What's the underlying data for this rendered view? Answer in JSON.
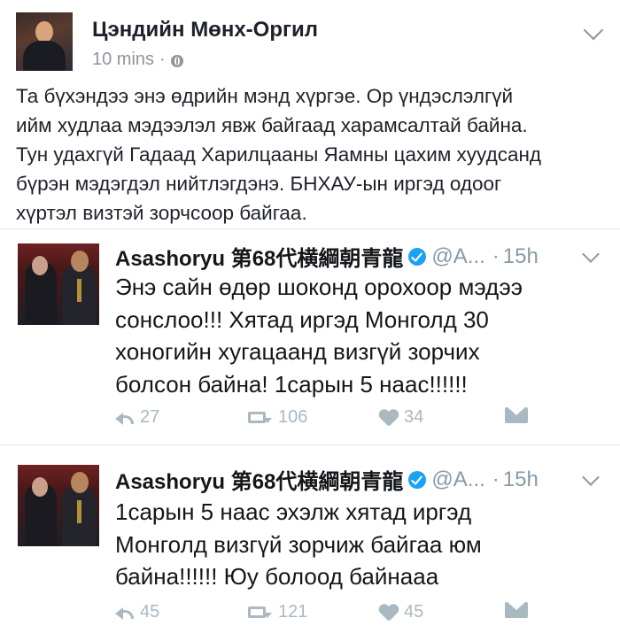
{
  "post": {
    "author": "Цэндийн Мөнх-Оргил",
    "time": "10 mins",
    "separator": "·",
    "text": "Та бүхэндээ энэ өдрийн мэнд хүргэе. Ор үндэслэлгүй\nийм худлаа мэдээлэл явж байгаад харамсалтай байна.\nТун удахгүй Гадаад Харилцааны Яамны цахим хуудсанд\nбүрэн мэдэгдэл нийтлэгдэнэ. БНХАУ-ын иргэд одоог\nхүртэл визтэй зорчсоор байгаа."
  },
  "tweets": [
    {
      "name": "Asashoryu 第68代横綱朝青龍",
      "handle": "@A...",
      "separator": "·",
      "time": "15h",
      "text": "Энэ сайн өдөр шоконд орохоор мэдээ\nсонслоо!!! Хятад иргэд Монголд 30\nхоногийн хугацаанд визгүй зорчих\nболсон байна! 1сарын 5 наас!!!!!!",
      "replies": "27",
      "retweets": "106",
      "likes": "34"
    },
    {
      "name": "Asashoryu 第68代横綱朝青龍",
      "handle": "@A...",
      "separator": "·",
      "time": "15h",
      "text": "1сарын 5 наас эхэлж хятад иргэд\nМонголд визгүй зорчиж байгаа юм\nбайна!!!!!! Юу болоод байнааа",
      "replies": "45",
      "retweets": "121",
      "likes": "45"
    }
  ],
  "icons": {
    "globe": "globe-icon",
    "chevron": "chevron-down-icon",
    "verified": "verified-badge-icon",
    "reply": "reply-icon",
    "retweet": "retweet-icon",
    "like": "heart-icon",
    "dm": "direct-message-icon"
  },
  "colors": {
    "twitter_blue": "#1da1f2",
    "action_gray": "#aab8c2",
    "meta_gray": "#90949c"
  }
}
